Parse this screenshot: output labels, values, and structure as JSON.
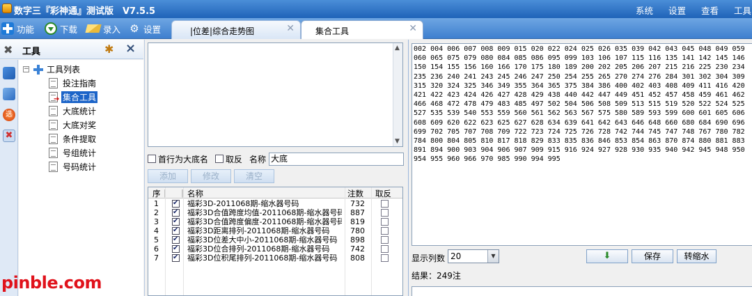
{
  "app": {
    "title": "数字三『彩神通』测试版　V7.5.5",
    "menu": [
      "系统",
      "设置",
      "查看",
      "工具"
    ]
  },
  "toolbar": {
    "items": [
      {
        "label": "功能",
        "icon": "plus-icon"
      },
      {
        "label": "下载",
        "icon": "download-icon"
      },
      {
        "label": "录入",
        "icon": "input-icon"
      },
      {
        "label": "设置",
        "icon": "gear-icon"
      }
    ]
  },
  "tabs": [
    {
      "label": "|位差|综合走势图",
      "active": false
    },
    {
      "label": "集合工具",
      "active": true
    }
  ],
  "sidebar": {
    "title": "工具",
    "tree_root": "工具列表",
    "items": [
      {
        "label": "投注指南",
        "selected": false
      },
      {
        "label": "集合工具",
        "selected": true
      },
      {
        "label": "大底统计",
        "selected": false
      },
      {
        "label": "大底对奖",
        "selected": false
      },
      {
        "label": "条件提取",
        "selected": false
      },
      {
        "label": "号组统计",
        "selected": false
      },
      {
        "label": "号码统计",
        "selected": false
      }
    ],
    "strip_icons": [
      "chart-icon",
      "filter-icon",
      "pick-icon",
      "tools-icon"
    ],
    "strip_pick_text": "选"
  },
  "options": {
    "first_line_label": "首行为大底名",
    "first_line_checked": false,
    "invert_label": "取反",
    "invert_checked": false,
    "name_label": "名称",
    "name_value": "大底"
  },
  "buttons": {
    "add": "添加",
    "edit": "修改",
    "clear": "清空"
  },
  "grid": {
    "headers": {
      "seq": "序",
      "name": "名称",
      "count": "注数",
      "invert": "取反"
    },
    "rows": [
      {
        "seq": "1",
        "name": "福彩3D-2011068期-缩水器号码",
        "count": "732",
        "checked": true,
        "invert": false
      },
      {
        "seq": "2",
        "name": "福彩3D合值跨度均值-2011068期-缩水器号码",
        "count": "887",
        "checked": true,
        "invert": false
      },
      {
        "seq": "3",
        "name": "福彩3D合值跨度偏度-2011068期-缩水器号码",
        "count": "819",
        "checked": true,
        "invert": false
      },
      {
        "seq": "4",
        "name": "福彩3D距离排列-2011068期-缩水器号码",
        "count": "780",
        "checked": true,
        "invert": false
      },
      {
        "seq": "5",
        "name": "福彩3D位差大中小-2011068期-缩水器号码",
        "count": "898",
        "checked": true,
        "invert": false
      },
      {
        "seq": "6",
        "name": "福彩3D位合排列-2011068期-缩水器号码",
        "count": "742",
        "checked": true,
        "invert": false
      },
      {
        "seq": "7",
        "name": "福彩3D位积尾排列-2011068期-缩水器号码",
        "count": "808",
        "checked": true,
        "invert": false
      }
    ]
  },
  "result": {
    "lines": [
      "002 004 006 007 008 009 015 020 022 024 025 026 035 039 042 043 045 048 049 059",
      "060 065 075 079 080 084 085 086 095 099 103 106 107 115 116 135 141 142 145 146",
      "150 154 155 156 160 166 170 175 180 189 200 202 205 206 207 215 216 225 230 234",
      "235 236 240 241 243 245 246 247 250 254 255 265 270 274 276 284 301 302 304 309",
      "315 320 324 325 346 349 355 364 365 375 384 386 400 402 403 408 409 411 416 420",
      "421 422 423 424 426 427 428 429 438 440 442 447 449 451 452 457 458 459 461 462",
      "466 468 472 478 479 483 485 497 502 504 506 508 509 513 515 519 520 522 524 525",
      "527 535 539 540 553 559 560 561 562 563 567 575 580 589 593 599 600 601 605 606",
      "608 609 620 622 623 625 627 628 634 639 641 642 643 646 648 660 680 684 690 696",
      "699 702 705 707 708 709 722 723 724 725 726 728 742 744 745 747 748 767 780 782",
      "784 800 804 805 810 817 818 829 833 835 836 846 853 854 863 870 874 880 881 883",
      "891 894 900 903 904 906 907 909 915 916 924 927 928 930 935 940 942 945 948 950",
      "954 955 960 966 970 985 990 994 995"
    ],
    "columns_label": "显示列数",
    "columns_value": "20",
    "save_label": "保存",
    "convert_label": "转缩水",
    "export_icon": "down-arrow-icon",
    "count_text": "结果：249注"
  },
  "watermark": "pinble.com",
  "colors": {
    "titlebar": "#1f63b8",
    "toolbar": "#3e7fcf",
    "selection": "#1c64c8",
    "watermark": "#e0121b"
  }
}
